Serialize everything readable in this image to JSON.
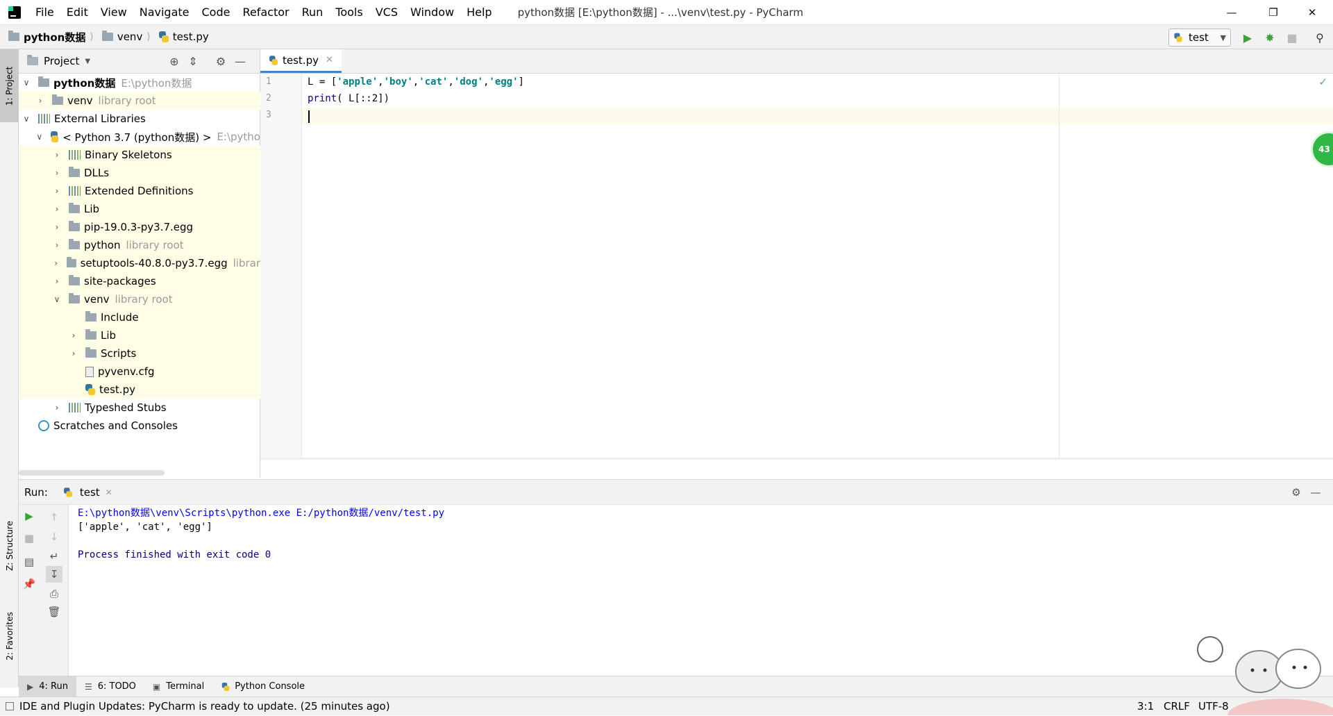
{
  "titlebar": {
    "menus": [
      "File",
      "Edit",
      "View",
      "Navigate",
      "Code",
      "Refactor",
      "Run",
      "Tools",
      "VCS",
      "Window",
      "Help"
    ],
    "window_title": "python数据 [E:\\python数据] - ...\\venv\\test.py - PyCharm"
  },
  "navbar": {
    "breadcrumbs": [
      "python数据",
      "venv",
      "test.py"
    ],
    "run_config": "test"
  },
  "left_strip": {
    "project_tab": "1: Project",
    "structure_tab": "Z: Structure",
    "favorites_tab": "2: Favorites"
  },
  "project": {
    "header": "Project",
    "tree": [
      {
        "label": "python数据",
        "hint": "E:\\python数据",
        "bold": true
      },
      {
        "label": "venv",
        "hint": "library root"
      },
      {
        "label": "External Libraries",
        "hint": ""
      },
      {
        "label": "< Python 3.7 (python数据) >",
        "hint": "E:\\pytho"
      },
      {
        "label": "Binary Skeletons",
        "hint": ""
      },
      {
        "label": "DLLs",
        "hint": ""
      },
      {
        "label": "Extended Definitions",
        "hint": ""
      },
      {
        "label": "Lib",
        "hint": ""
      },
      {
        "label": "pip-19.0.3-py3.7.egg",
        "hint": ""
      },
      {
        "label": "python",
        "hint": "library root"
      },
      {
        "label": "setuptools-40.8.0-py3.7.egg",
        "hint": "librar"
      },
      {
        "label": "site-packages",
        "hint": ""
      },
      {
        "label": "venv",
        "hint": "library root"
      },
      {
        "label": "Include",
        "hint": ""
      },
      {
        "label": "Lib",
        "hint": ""
      },
      {
        "label": "Scripts",
        "hint": ""
      },
      {
        "label": "pyvenv.cfg",
        "hint": ""
      },
      {
        "label": "test.py",
        "hint": ""
      },
      {
        "label": "Typeshed Stubs",
        "hint": ""
      },
      {
        "label": "Scratches and Consoles",
        "hint": ""
      }
    ]
  },
  "editor": {
    "tab": "test.py",
    "line_numbers": [
      "1",
      "2",
      "3"
    ],
    "code": {
      "l1_a": "L = [",
      "l1_s1": "'apple'",
      "l1_s2": "'boy'",
      "l1_s3": "'cat'",
      "l1_s4": "'dog'",
      "l1_s5": "'egg'",
      "comma": ",",
      "l1_end": "]",
      "l2_fn": "print",
      "l2_rest": "( L[::2])"
    },
    "badge": "43"
  },
  "run": {
    "label": "Run:",
    "tab": "test",
    "console": [
      "E:\\python数据\\venv\\Scripts\\python.exe E:/python数据/venv/test.py",
      "['apple', 'cat', 'egg']",
      "",
      "Process finished with exit code 0"
    ]
  },
  "tool_tabs": [
    "4: Run",
    "6: TODO",
    "Terminal",
    "Python Console"
  ],
  "status": {
    "message": "IDE and Plugin Updates: PyCharm is ready to update. (25 minutes ago)",
    "position": "3:1",
    "line_sep": "CRLF",
    "encoding": "UTF-8"
  },
  "colors": {
    "accent": "#4083c9",
    "string": "#008080",
    "keyword": "#000080",
    "console_blue": "#0000ff"
  }
}
